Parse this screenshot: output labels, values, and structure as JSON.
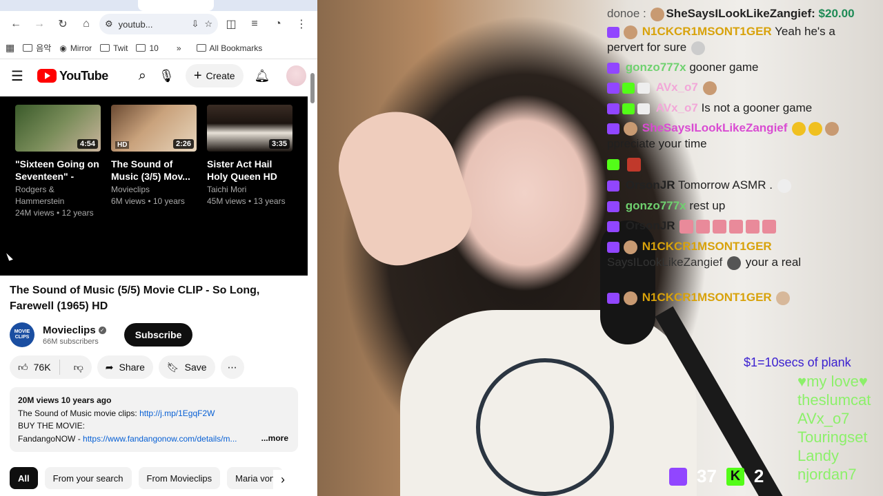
{
  "browser": {
    "url": "youtub...",
    "bookmarks": [
      "음악",
      "Mirror",
      "Twit",
      "10"
    ],
    "bookmarks_overflow": "»",
    "all_bookmarks": "All Bookmarks"
  },
  "youtube": {
    "logo_text": "YouTube",
    "create_label": "Create",
    "endcards": [
      {
        "title": "\"Sixteen Going on Seventeen\" - The...",
        "channel": "Rodgers & Hammerstein",
        "meta": "24M views • 12 years",
        "duration": "4:54",
        "hd": ""
      },
      {
        "title": "The Sound of Music (3/5) Mov...",
        "channel": "Movieclips",
        "meta": "6M views • 10 years",
        "duration": "2:26",
        "hd": "HD"
      },
      {
        "title": "Sister Act Hail Holy Queen HD",
        "channel": "Taichi Mori",
        "meta": "45M views • 13 years",
        "duration": "3:35",
        "hd": ""
      }
    ],
    "video_title": "The Sound of Music (5/5) Movie CLIP - So Long, Farewell (1965) HD",
    "channel_name": "Movieclips",
    "channel_avatar_text": "MOVIE CLIPS",
    "subscribers": "66M subscribers",
    "subscribe_label": "Subscribe",
    "likes": "76K",
    "share_label": "Share",
    "save_label": "Save",
    "description": {
      "stats": "20M views  10 years ago",
      "line1_text": "The Sound of Music movie clips: ",
      "line1_link": "http://j.mp/1EgqF2W",
      "line2": "BUY THE MOVIE:",
      "line3_text": "FandangoNOW - ",
      "line3_link": "https://www.fandangonow.com/details/m...",
      "more": "...more"
    },
    "chips": [
      "All",
      "From your search",
      "From Movieclips",
      "Maria von"
    ]
  },
  "stream": {
    "chat": [
      {
        "name": "SheSaysILookLikeZangief:",
        "text": "",
        "amount": "$20.00",
        "color": "dark",
        "prefix": "donoe :"
      },
      {
        "name": "N1CKCR1MSONT1GER",
        "text": "Yeah he's a",
        "color": "orange"
      },
      {
        "name": "",
        "text": "pervert for sure",
        "color": "dark"
      },
      {
        "name": "gonzo777x",
        "text": "gooner game",
        "color": "green"
      },
      {
        "name": "AVx_o7",
        "text": "",
        "color": "lpink"
      },
      {
        "name": "AVx_o7",
        "text": "Is not a gooner game",
        "color": "lpink"
      },
      {
        "name": "SheSaysILookLikeZangief",
        "text": "",
        "color": "pink"
      },
      {
        "name": "",
        "text": "ppreciate your time",
        "color": "dark"
      },
      {
        "name": "",
        "text": "",
        "color": "blue"
      },
      {
        "name": "OrsonJR",
        "text": "Tomorrow ASMR .",
        "color": "dark"
      },
      {
        "name": "gonzo777x",
        "text": "rest up",
        "color": "green"
      },
      {
        "name": "OrsonJR",
        "text": "",
        "color": "dark"
      },
      {
        "name": "N1CKCR1MSONT1GER",
        "text": "",
        "color": "orange"
      },
      {
        "name": "",
        "text": "SaysILookLikeZangief",
        "suffix": "your a real",
        "color": "dark"
      },
      {
        "name": "N1CKCR1MSONT1GER",
        "text": "",
        "color": "orange"
      }
    ],
    "plank": "$1=10secs of plank",
    "donors": [
      "♥my love♥",
      "theslumcat",
      "AVx_o7",
      "Touringset",
      "Landy",
      "njordan7"
    ],
    "twitch_count": "37",
    "kick_count": "2"
  }
}
